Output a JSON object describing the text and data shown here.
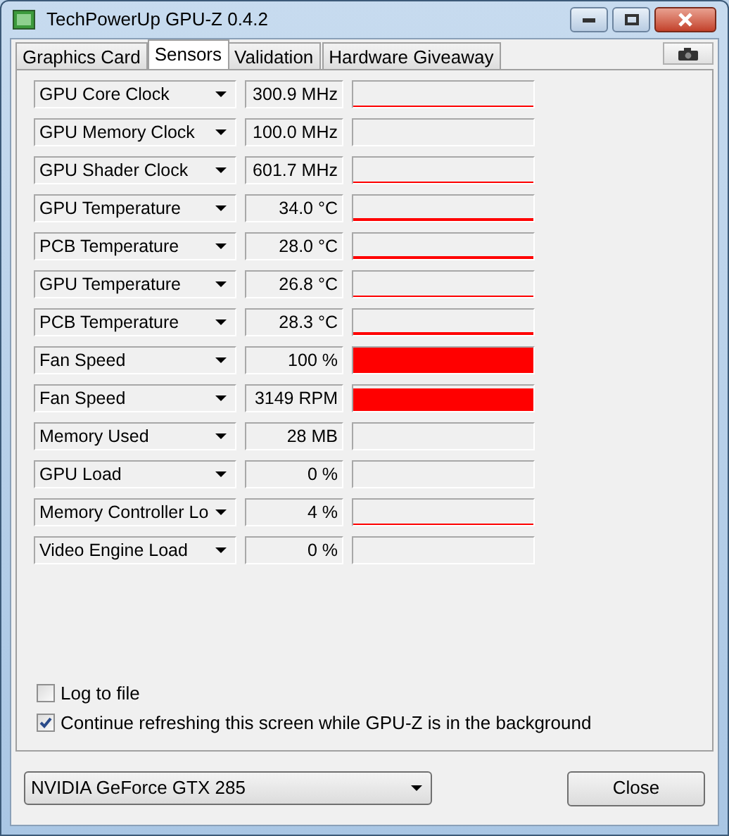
{
  "window": {
    "title": "TechPowerUp GPU-Z 0.4.2"
  },
  "tabs": [
    {
      "label": "Graphics Card",
      "selected": false
    },
    {
      "label": "Sensors",
      "selected": true
    },
    {
      "label": "Validation",
      "selected": false
    },
    {
      "label": "Hardware Giveaway",
      "selected": false
    }
  ],
  "sensors": [
    {
      "name": "GPU Core Clock",
      "reading": "300.9 MHz"
    },
    {
      "name": "GPU Memory Clock",
      "reading": "100.0 MHz"
    },
    {
      "name": "GPU Shader Clock",
      "reading": "601.7 MHz"
    },
    {
      "name": "GPU Temperature",
      "reading": "34.0 °C"
    },
    {
      "name": "PCB Temperature",
      "reading": "28.0 °C"
    },
    {
      "name": "GPU Temperature",
      "reading": "26.8 °C"
    },
    {
      "name": "PCB Temperature",
      "reading": "28.3 °C"
    },
    {
      "name": "Fan Speed",
      "reading": "100 %"
    },
    {
      "name": "Fan Speed",
      "reading": "3149 RPM"
    },
    {
      "name": "Memory Used",
      "reading": "28 MB"
    },
    {
      "name": "GPU Load",
      "reading": "0 %"
    },
    {
      "name": "Memory Controller Lo",
      "reading": "4 %"
    },
    {
      "name": "Video Engine Load",
      "reading": "0 %"
    }
  ],
  "options": [
    {
      "label": "Log to file",
      "checked": false
    },
    {
      "label": "Continue refreshing this screen while GPU-Z is in the background",
      "checked": true
    }
  ],
  "gpu_select": {
    "value": "NVIDIA GeForce GTX 285"
  },
  "buttons": [
    "Close"
  ]
}
